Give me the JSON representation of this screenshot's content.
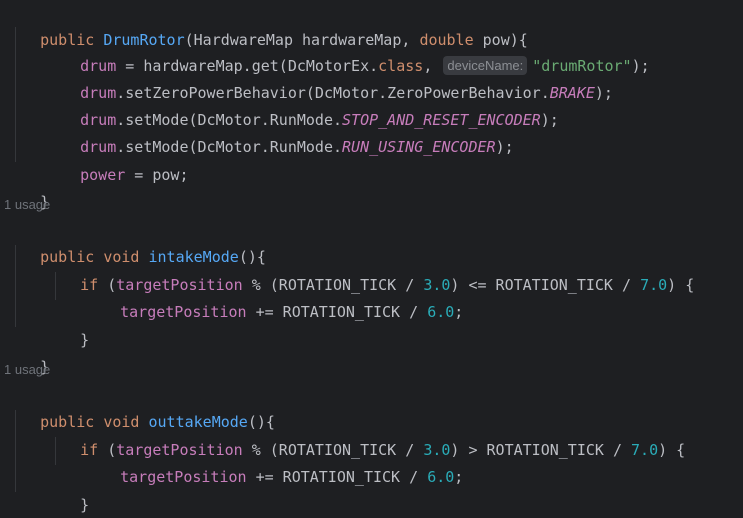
{
  "code": {
    "ctor_public": "public",
    "ctor_name": "DrumRotor",
    "ctor_params_a": "(HardwareMap hardwareMap, ",
    "ctor_double": "double",
    "ctor_params_b": " pow){",
    "drum": "drum",
    "assign_get_a": " = hardwareMap.get(DcMotorEx.",
    "class_kw": "class",
    "assign_get_b": ", ",
    "device_hint": "deviceName:",
    "device_str": "\"drumRotor\"",
    "assign_get_end": ");",
    "zpb_call": ".setZeroPowerBehavior(DcMotor.ZeroPowerBehavior.",
    "brake": "BRAKE",
    "close_paren": ");",
    "setmode_call": ".setMode(DcMotor.RunMode.",
    "stop_reset": "STOP_AND_RESET_ENCODER",
    "run_using": "RUN_USING_ENCODER",
    "power": "power",
    "power_assign": " = pow;",
    "close_brace": "}",
    "usage_label": "1 usage",
    "public_void": "public void ",
    "intake_name": "intakeMode",
    "outtake_name": "outtakeMode",
    "method_sig_end": "(){",
    "if_kw": "if",
    "open_paren": " (",
    "target_position": "targetPosition",
    "mod_open": " % (ROTATION_TICK / ",
    "num_3": "3.0",
    "le_rot": ") <= ROTATION_TICK / ",
    "gt_rot": ") > ROTATION_TICK / ",
    "num_7": "7.0",
    "if_end": ") {",
    "plus_eq_rot": " += ROTATION_TICK / ",
    "num_6": "6.0",
    "semicolon": ";"
  },
  "colors": {
    "background": "#1e1f22",
    "keyword": "#cf8e6d",
    "function": "#56a8f5",
    "field": "#c77dbb",
    "number": "#2aacb8",
    "string": "#6aab73",
    "default_text": "#bcbec4",
    "usage_hint": "#6f737a"
  }
}
